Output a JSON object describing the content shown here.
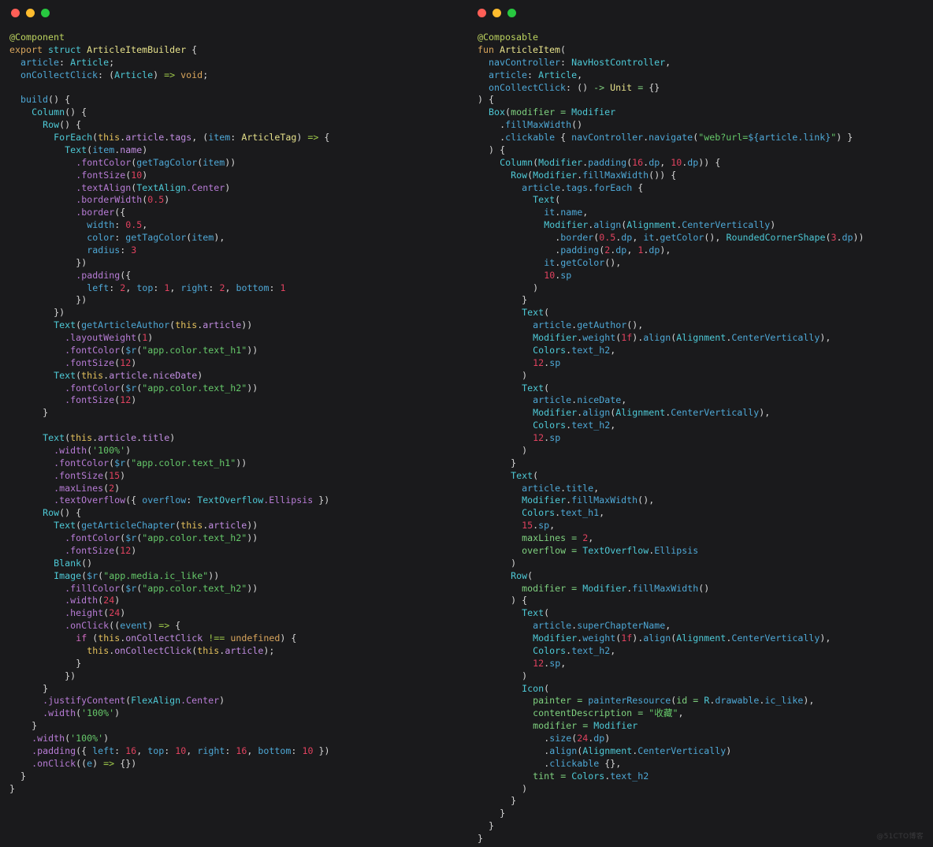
{
  "window": {
    "background": "#18191b",
    "panel_background": "#1a1a1c",
    "traffic_lights": [
      "close",
      "minimize",
      "zoom"
    ],
    "traffic_light_colors": {
      "close": "#ff5f57",
      "minimize": "#febc2e",
      "zoom": "#28c840"
    }
  },
  "watermark": "@51CTO博客",
  "top_mark": "↟",
  "left_panel": {
    "language": "ArkTS",
    "lines": [
      "@Component",
      "export struct ArticleItemBuilder {",
      "  article: Article;",
      "  onCollectClick: (Article) => void;",
      "",
      "  build() {",
      "    Column() {",
      "      Row() {",
      "        ForEach(this.article.tags, (item: ArticleTag) => {",
      "          Text(item.name)",
      "            .fontColor(getTagColor(item))",
      "            .fontSize(10)",
      "            .textAlign(TextAlign.Center)",
      "            .borderWidth(0.5)",
      "            .border({",
      "              width: 0.5,",
      "              color: getTagColor(item),",
      "              radius: 3",
      "            })",
      "            .padding({",
      "              left: 2, top: 1, right: 2, bottom: 1",
      "            })",
      "        })",
      "        Text(getArticleAuthor(this.article))",
      "          .layoutWeight(1)",
      "          .fontColor($r(\"app.color.text_h1\"))",
      "          .fontSize(12)",
      "        Text(this.article.niceDate)",
      "          .fontColor($r(\"app.color.text_h2\"))",
      "          .fontSize(12)",
      "      }",
      "",
      "      Text(this.article.title)",
      "        .width('100%')",
      "        .fontColor($r(\"app.color.text_h1\"))",
      "        .fontSize(15)",
      "        .maxLines(2)",
      "        .textOverflow({ overflow: TextOverflow.Ellipsis })",
      "      Row() {",
      "        Text(getArticleChapter(this.article))",
      "          .fontColor($r(\"app.color.text_h2\"))",
      "          .fontSize(12)",
      "        Blank()",
      "        Image($r(\"app.media.ic_like\"))",
      "          .fillColor($r(\"app.color.text_h2\"))",
      "          .width(24)",
      "          .height(24)",
      "          .onClick((event) => {",
      "            if (this.onCollectClick !== undefined) {",
      "              this.onCollectClick(this.article);",
      "            }",
      "          })",
      "      }",
      "      .justifyContent(FlexAlign.Center)",
      "      .width('100%')",
      "    }",
      "    .width('100%')",
      "    .padding({ left: 16, top: 10, right: 16, bottom: 10 })",
      "    .onClick((e) => {})",
      "  }",
      "}"
    ]
  },
  "right_panel": {
    "language": "Kotlin Compose",
    "lines": [
      "@Composable",
      "fun ArticleItem(",
      "  navController: NavHostController,",
      "  article: Article,",
      "  onCollectClick: () -> Unit = {}",
      ") {",
      "  Box(modifier = Modifier",
      "    .fillMaxWidth()",
      "    .clickable { navController.navigate(\"web?url=${article.link}\") }",
      "  ) {",
      "    Column(Modifier.padding(16.dp, 10.dp)) {",
      "      Row(Modifier.fillMaxWidth()) {",
      "        article.tags.forEach {",
      "          Text(",
      "            it.name,",
      "            Modifier.align(Alignment.CenterVertically)",
      "              .border(0.5.dp, it.getColor(), RoundedCornerShape(3.dp))",
      "              .padding(2.dp, 1.dp),",
      "            it.getColor(),",
      "            10.sp",
      "          )",
      "        }",
      "        Text(",
      "          article.getAuthor(),",
      "          Modifier.weight(1f).align(Alignment.CenterVertically),",
      "          Colors.text_h2,",
      "          12.sp",
      "        )",
      "        Text(",
      "          article.niceDate,",
      "          Modifier.align(Alignment.CenterVertically),",
      "          Colors.text_h2,",
      "          12.sp",
      "        )",
      "      }",
      "      Text(",
      "        article.title,",
      "        Modifier.fillMaxWidth(),",
      "        Colors.text_h1,",
      "        15.sp,",
      "        maxLines = 2,",
      "        overflow = TextOverflow.Ellipsis",
      "      )",
      "      Row(",
      "        modifier = Modifier.fillMaxWidth()",
      "      ) {",
      "        Text(",
      "          article.superChapterName,",
      "          Modifier.weight(1f).align(Alignment.CenterVertically),",
      "          Colors.text_h2,",
      "          12.sp,",
      "        )",
      "        Icon(",
      "          painter = painterResource(id = R.drawable.ic_like),",
      "          contentDescription = \"收藏\",",
      "          modifier = Modifier",
      "            .size(24.dp)",
      "            .align(Alignment.CenterVertically)",
      "            .clickable {},",
      "          tint = Colors.text_h2",
      "        )",
      "      }",
      "    }",
      "  }",
      "}"
    ]
  }
}
